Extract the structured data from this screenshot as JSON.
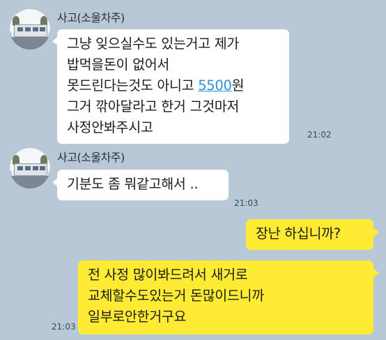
{
  "messages": [
    {
      "sender": "사고(소울차주)",
      "time": "21:02",
      "lines": [
        "그냥 잊으실수도 있는거고 제가",
        "밥먹을돈이 없어서",
        "못드린다는것도 아니고 ",
        "그거 깎아달라고 한거 그것마저",
        "사정안봐주시고"
      ],
      "amount": "5500",
      "amount_suffix": "원"
    },
    {
      "sender": "사고(소울차주)",
      "time": "21:03",
      "lines": [
        "기분도 좀 뭐같고해서 .."
      ]
    },
    {
      "lines": [
        "장난 하십니까?"
      ]
    },
    {
      "time": "21:03",
      "lines": [
        "전 사정 많이봐드려서 새거로",
        "교체할수도있는거 돈많이드니까",
        "일부로안한거구요"
      ]
    }
  ],
  "colors": {
    "background": "#b9c8d6",
    "incoming_bubble": "#ffffff",
    "outgoing_bubble": "#ffeb33",
    "link": "#2d8fd6"
  },
  "icons": {
    "avatar": "profile-photo-bus"
  }
}
